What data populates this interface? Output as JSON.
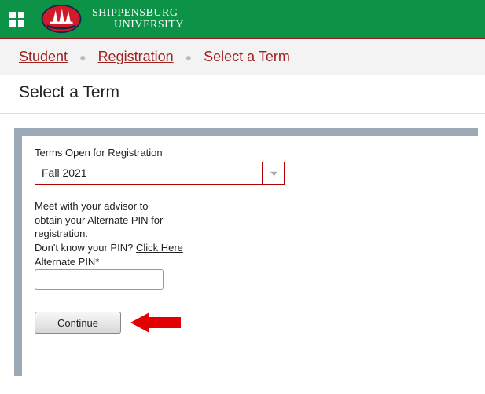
{
  "header": {
    "university_line1": "SHIPPENSBURG",
    "university_line2": "UNIVERSITY"
  },
  "breadcrumb": {
    "items": [
      {
        "label": "Student",
        "link": true
      },
      {
        "label": "Registration",
        "link": true
      },
      {
        "label": "Select a Term",
        "link": false
      }
    ]
  },
  "page": {
    "title": "Select a Term"
  },
  "form": {
    "terms_label": "Terms Open for Registration",
    "term_selected": "Fall 2021",
    "advisor_line1": "Meet with your advisor to",
    "advisor_line2": "obtain your Alternate PIN for",
    "advisor_line3": "registration.",
    "pin_question": "Don't know your PIN? ",
    "click_here_label": "Click Here",
    "pin_label": "Alternate PIN*",
    "pin_value": "",
    "continue_label": "Continue"
  }
}
